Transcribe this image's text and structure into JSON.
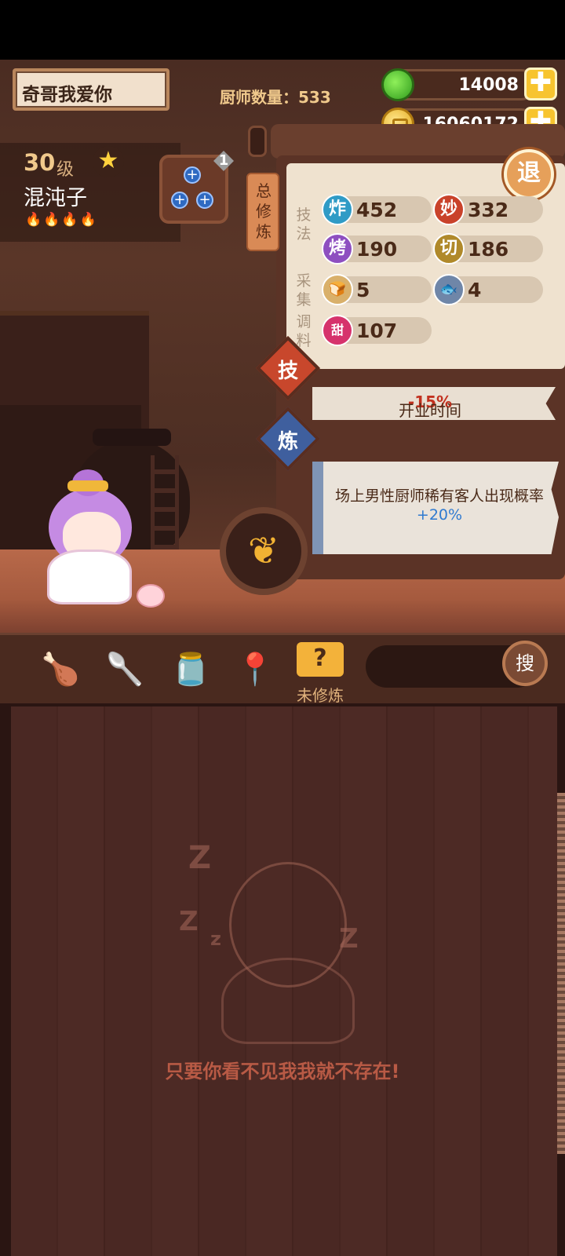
{
  "header": {
    "player_name": "奇哥我爱你",
    "chef_count_label": "厨师数量：",
    "chef_count_value": "533"
  },
  "currency": {
    "jade_amount": "14008",
    "coin_amount": "16060172",
    "plus_symbol": "✚"
  },
  "chef": {
    "level": "30",
    "level_unit": "级",
    "name": "混沌子",
    "flames": "🔥🔥🔥🔥",
    "equip_badge": "1"
  },
  "panel": {
    "side_tag": "总修炼",
    "exit_label": "退",
    "categories": {
      "technique": "技法",
      "gather": "采集",
      "season": "调料"
    },
    "stats": [
      {
        "icon": "炸",
        "value": "452",
        "color": "#2f9bc6"
      },
      {
        "icon": "妙",
        "value": "332",
        "color": "#c9422a"
      },
      {
        "icon": "烤",
        "value": "190",
        "color": "#8e4fc0"
      },
      {
        "icon": "切",
        "value": "186",
        "color": "#b0892a"
      },
      {
        "icon": "🍞",
        "value": "5",
        "color": "#d9b06a"
      },
      {
        "icon": "🐟",
        "value": "4",
        "color": "#6f86a8"
      },
      {
        "icon": "甜",
        "value": "107",
        "color": "#d6336c"
      }
    ]
  },
  "skill": {
    "tag": "技",
    "text_prefix": "开业时间",
    "text_value": "-15%"
  },
  "train": {
    "tag": "炼",
    "text_prefix": "场上男性厨师稀有客人出现概率",
    "text_value": "+20%"
  },
  "toolbar": {
    "icons": [
      "🍗",
      "🥄",
      "🫙",
      "📍"
    ],
    "active_icon": "?",
    "active_label": "未修炼",
    "search_label": "搜"
  },
  "empty_state": {
    "message": "只要你看不见我我就不存在!",
    "z_glyphs": [
      "Z",
      "Z",
      "z",
      "Z"
    ]
  },
  "colors": {
    "accent_gold": "#f7c42f",
    "text_brown": "#4a2a18",
    "warn_red": "#c2311f",
    "bonus_blue": "#2f7ad0"
  }
}
